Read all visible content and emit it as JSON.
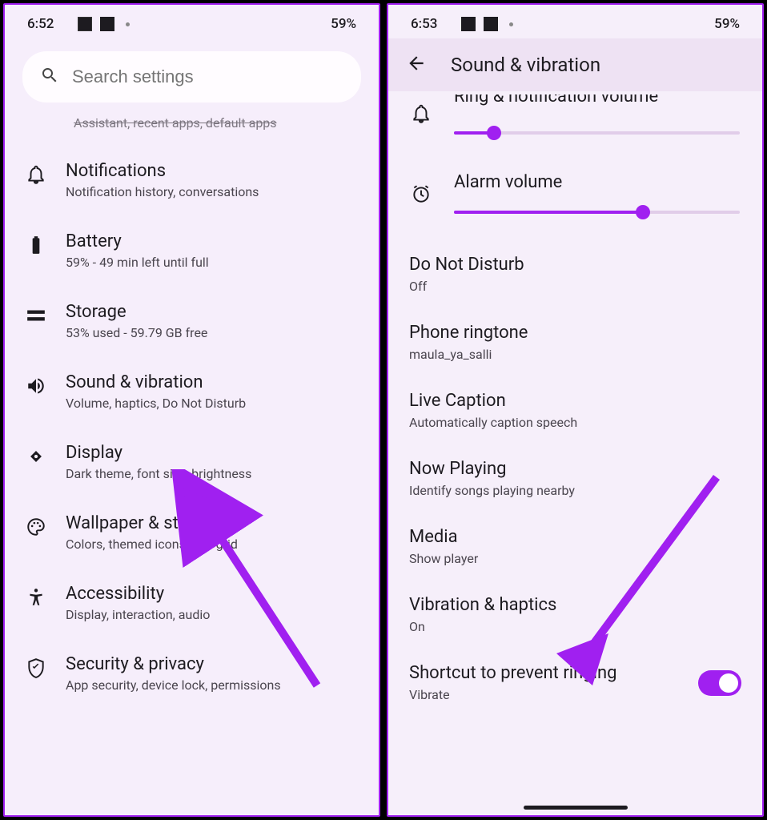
{
  "left": {
    "status": {
      "time": "6:52",
      "battery": "59%"
    },
    "search": {
      "placeholder": "Search settings"
    },
    "truncated_top": "Assistant, recent apps, default apps",
    "items": [
      {
        "title": "Notifications",
        "sub": "Notification history, conversations"
      },
      {
        "title": "Battery",
        "sub": "59% - 49 min left until full"
      },
      {
        "title": "Storage",
        "sub": "53% used - 59.79 GB free"
      },
      {
        "title": "Sound & vibration",
        "sub": "Volume, haptics, Do Not Disturb"
      },
      {
        "title": "Display",
        "sub": "Dark theme, font size, brightness"
      },
      {
        "title": "Wallpaper & style",
        "sub": "Colors, themed icons, app grid"
      },
      {
        "title": "Accessibility",
        "sub": "Display, interaction, audio"
      },
      {
        "title": "Security & privacy",
        "sub": "App security, device lock, permissions"
      }
    ]
  },
  "right": {
    "status": {
      "time": "6:53",
      "battery": "59%"
    },
    "header": "Sound & vibration",
    "volumes": {
      "ring_label": "Ring & notification volume",
      "ring_pct": 14,
      "alarm_label": "Alarm volume",
      "alarm_pct": 66
    },
    "rows": [
      {
        "title": "Do Not Disturb",
        "sub": "Off"
      },
      {
        "title": "Phone ringtone",
        "sub": "maula_ya_salli"
      },
      {
        "title": "Live Caption",
        "sub": "Automatically caption speech"
      },
      {
        "title": "Now Playing",
        "sub": "Identify songs playing nearby"
      },
      {
        "title": "Media",
        "sub": "Show player"
      },
      {
        "title": "Vibration & haptics",
        "sub": "On"
      }
    ],
    "shortcut": {
      "title": "Shortcut to prevent ringing",
      "sub": "Vibrate"
    }
  }
}
